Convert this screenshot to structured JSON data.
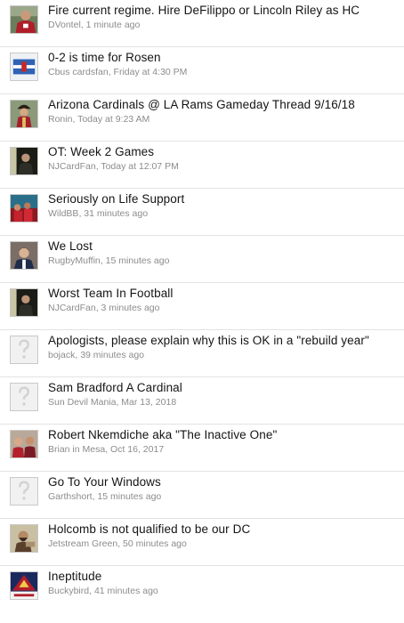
{
  "threads": [
    {
      "title": "Fire current regime. Hire DeFilippo or Lincoln Riley as HC",
      "author": "DVontel",
      "time": "1 minute ago",
      "avatar": "player-red-photo"
    },
    {
      "title": "0-2 is time for Rosen",
      "author": "Cbus cardsfan",
      "time": "Friday at 4:30 PM",
      "avatar": "flag-logo"
    },
    {
      "title": "Arizona Cardinals @ LA Rams Gameday Thread 9/16/18",
      "author": "Ronin",
      "time": "Today at 9:23 AM",
      "avatar": "costume-photo"
    },
    {
      "title": "OT: Week 2 Games",
      "author": "NJCardFan",
      "time": "Today at 12:07 PM",
      "avatar": "dark-figure-photo"
    },
    {
      "title": "Seriously on Life Support",
      "author": "WildBB",
      "time": "31 minutes ago",
      "avatar": "crowd-red-photo"
    },
    {
      "title": "We Lost",
      "author": "RugbyMuffin",
      "time": "15 minutes ago",
      "avatar": "man-portrait-photo"
    },
    {
      "title": "Worst Team In Football",
      "author": "NJCardFan",
      "time": "3 minutes ago",
      "avatar": "dark-figure-photo"
    },
    {
      "title": "Apologists, please explain why this is OK in a \"rebuild year\"",
      "author": "bojack",
      "time": "39 minutes ago",
      "avatar": "question-placeholder"
    },
    {
      "title": "Sam Bradford A Cardinal",
      "author": "Sun Devil Mania",
      "time": "Mar 13, 2018",
      "avatar": "question-placeholder"
    },
    {
      "title": "Robert Nkemdiche aka \"The Inactive One\"",
      "author": "Brian in Mesa",
      "time": "Oct 16, 2017",
      "avatar": "group-photo"
    },
    {
      "title": "Go To Your Windows",
      "author": "Garthshort",
      "time": "15 minutes ago",
      "avatar": "question-placeholder"
    },
    {
      "title": "Holcomb is not qualified to be our DC",
      "author": "Jetstream Green",
      "time": "50 minutes ago",
      "avatar": "bearded-man-photo"
    },
    {
      "title": "Ineptitude",
      "author": "Buckybird",
      "time": "41 minutes ago",
      "avatar": "cardinals-logo"
    }
  ],
  "meta_separator": ", ",
  "colors": {
    "title": "#141414",
    "meta": "#8c8c8c",
    "divider": "#e3e3e3"
  }
}
